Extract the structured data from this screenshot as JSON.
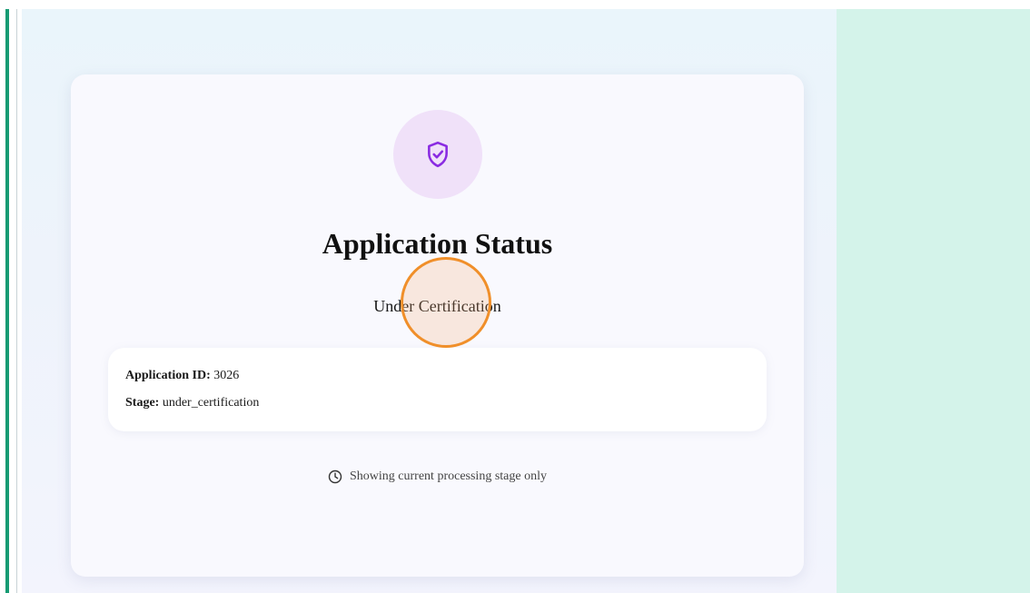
{
  "page": {
    "title": "Application Status",
    "status": "Under Certification"
  },
  "details": {
    "application_id_label": "Application ID:",
    "application_id_value": "3026",
    "stage_label": "Stage:",
    "stage_value": "under_certification"
  },
  "note": {
    "text": "Showing current processing stage only",
    "icon": "clock-icon"
  },
  "icons": {
    "status_icon": "shield-check-icon"
  },
  "colors": {
    "accent_left": "#169b73",
    "right_panel": "#d4f3ea",
    "icon_purple": "#8a2be2",
    "icon_bg": "#f0e1f9",
    "cursor_ring": "#f08f2a"
  }
}
